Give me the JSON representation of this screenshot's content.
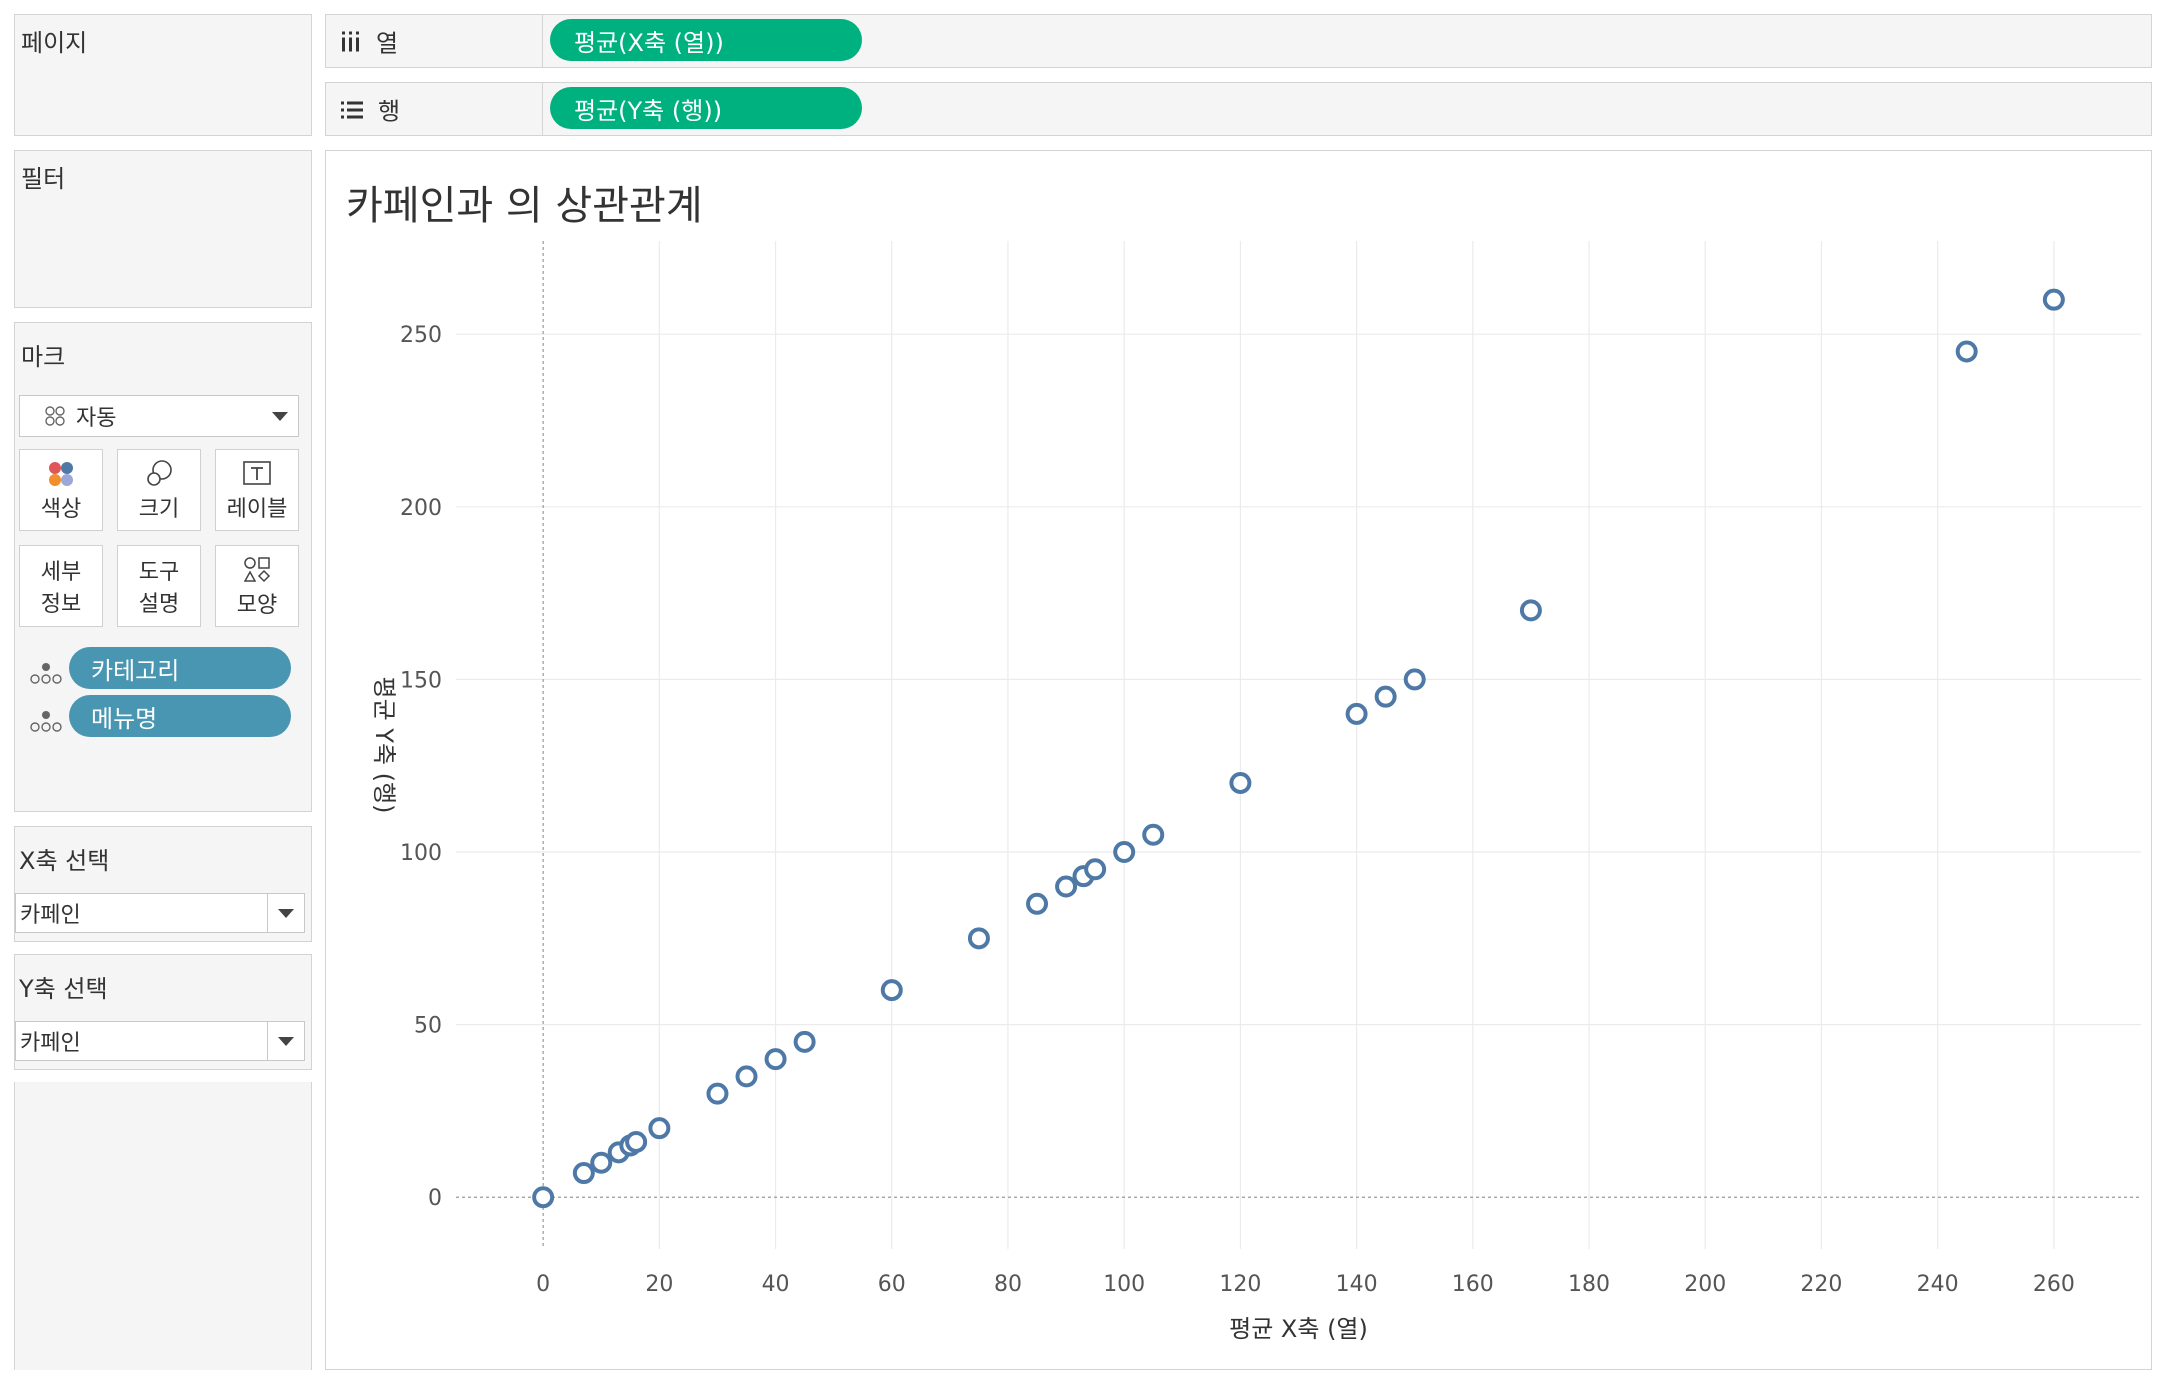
{
  "sidebar": {
    "pages_title": "페이지",
    "filters_title": "필터",
    "marks_title": "마크",
    "mark_type": "자동",
    "mark_buttons": {
      "color": "색상",
      "size": "크기",
      "label": "레이블",
      "detail_line1": "세부",
      "detail_line2": "정보",
      "tooltip_line1": "도구",
      "tooltip_line2": "설명",
      "shape": "모양"
    },
    "mark_fields": [
      "카테고리",
      "메뉴명"
    ],
    "x_param": {
      "title": "X축 선택",
      "value": "카페인"
    },
    "y_param": {
      "title": "Y축 선택",
      "value": "카페인"
    }
  },
  "shelves": {
    "columns_label": "열",
    "columns_pill": "평균(X축 (열))",
    "rows_label": "행",
    "rows_pill": "평균(Y축 (행))"
  },
  "colors": {
    "pill_green": "#00b180",
    "pill_blue": "#4996b2",
    "mark_stroke": "#4e79a7"
  },
  "chart_data": {
    "type": "scatter",
    "title": "카페인과 의 상관관계",
    "xlabel": "평균 X축 (열)",
    "ylabel": "평균 Y축 (행)",
    "xlim": [
      -15,
      275
    ],
    "ylim": [
      -15,
      277
    ],
    "xticks": [
      0,
      20,
      40,
      60,
      80,
      100,
      120,
      140,
      160,
      180,
      200,
      220,
      240,
      260
    ],
    "yticks": [
      0,
      50,
      100,
      150,
      200,
      250
    ],
    "grid": true,
    "points": [
      [
        0,
        0
      ],
      [
        7,
        7
      ],
      [
        10,
        10
      ],
      [
        13,
        13
      ],
      [
        15,
        15
      ],
      [
        16,
        16
      ],
      [
        20,
        20
      ],
      [
        30,
        30
      ],
      [
        35,
        35
      ],
      [
        40,
        40
      ],
      [
        45,
        45
      ],
      [
        60,
        60
      ],
      [
        75,
        75
      ],
      [
        85,
        85
      ],
      [
        90,
        90
      ],
      [
        93,
        93
      ],
      [
        95,
        95
      ],
      [
        100,
        100
      ],
      [
        105,
        105
      ],
      [
        120,
        120
      ],
      [
        140,
        140
      ],
      [
        145,
        145
      ],
      [
        150,
        150
      ],
      [
        170,
        170
      ],
      [
        245,
        245
      ],
      [
        260,
        260
      ]
    ]
  }
}
